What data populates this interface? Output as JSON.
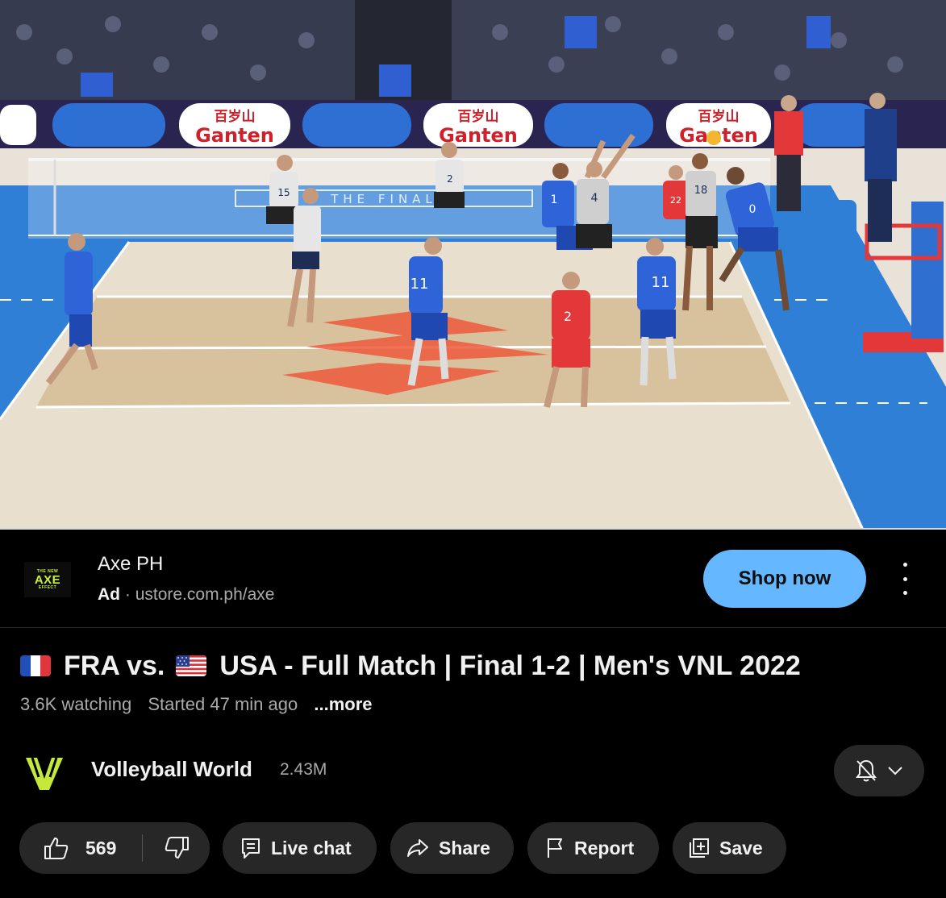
{
  "ad": {
    "logo_small_top": "THE NEW",
    "logo_brand": "AXE",
    "logo_small_bottom": "EFFECT",
    "advertiser": "Axe PH",
    "label": "Ad",
    "separator": "·",
    "url": "ustore.com.ph/axe",
    "cta": "Shop now"
  },
  "video": {
    "sponsor": "Ganten",
    "sponsor_cn": "百岁山",
    "court_text": "THE FINAL",
    "players_fra": [
      "11",
      "1",
      "11",
      "0"
    ],
    "players_usa": [
      "15",
      "2",
      "4",
      "18"
    ],
    "libero_number": "2",
    "libero_usa_number": "22"
  },
  "title": {
    "part1": "FRA vs.",
    "part2": "USA - Full Match | Final 1-2 | Men's VNL 2022"
  },
  "stats": {
    "watching": "3.6K watching",
    "started": "Started 47 min ago",
    "more": "...more"
  },
  "channel": {
    "name": "Volleyball World",
    "subscribers": "2.43M"
  },
  "actions": {
    "like_count": "569",
    "live_chat": "Live chat",
    "share": "Share",
    "report": "Report",
    "save": "Save"
  },
  "colors": {
    "shop_button": "#65b8ff",
    "pill_bg": "#272727",
    "court_blue": "#2f7fd6",
    "volleyball_world_green": "#c5e83a"
  }
}
